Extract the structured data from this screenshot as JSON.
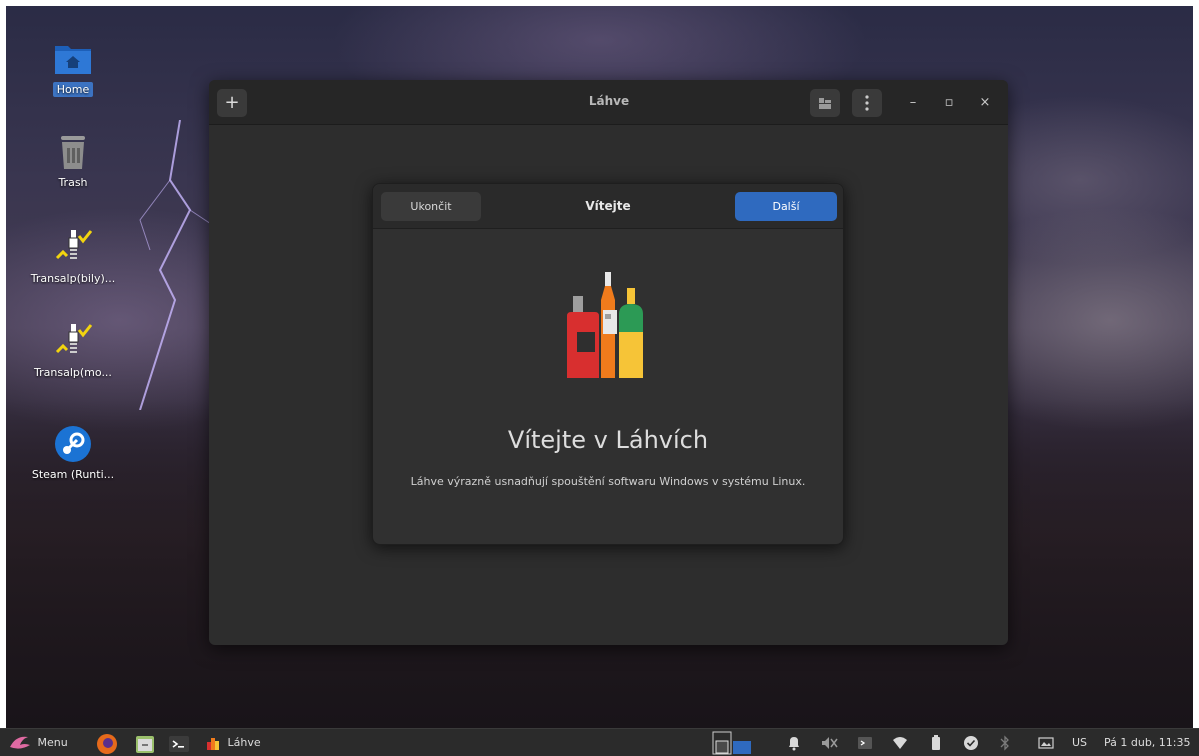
{
  "desktop": {
    "icons": [
      {
        "label": "Home"
      },
      {
        "label": "Trash"
      },
      {
        "label": "Transalp(bily)..."
      },
      {
        "label": "Transalp(mo..."
      },
      {
        "label": "Steam (Runti..."
      }
    ]
  },
  "window": {
    "title": "Láhve",
    "add_label": "+",
    "minimize_label": "–",
    "maximize_label": "▫",
    "close_label": "×"
  },
  "dialog": {
    "quit_label": "Ukončit",
    "title": "Vítejte",
    "next_label": "Další",
    "heading": "Vítejte v Láhvích",
    "description": "Láhve výrazně usnadňují spouštění softwaru Windows v systému Linux."
  },
  "taskbar": {
    "menu_label": "Menu",
    "window_button_label": "Láhve",
    "keyboard_layout": "US",
    "clock": "Pá 1 dub, 11:35"
  },
  "colors": {
    "accent": "#2f6abf",
    "window_bg": "#2d2d2d",
    "dialog_bg": "#303030"
  }
}
